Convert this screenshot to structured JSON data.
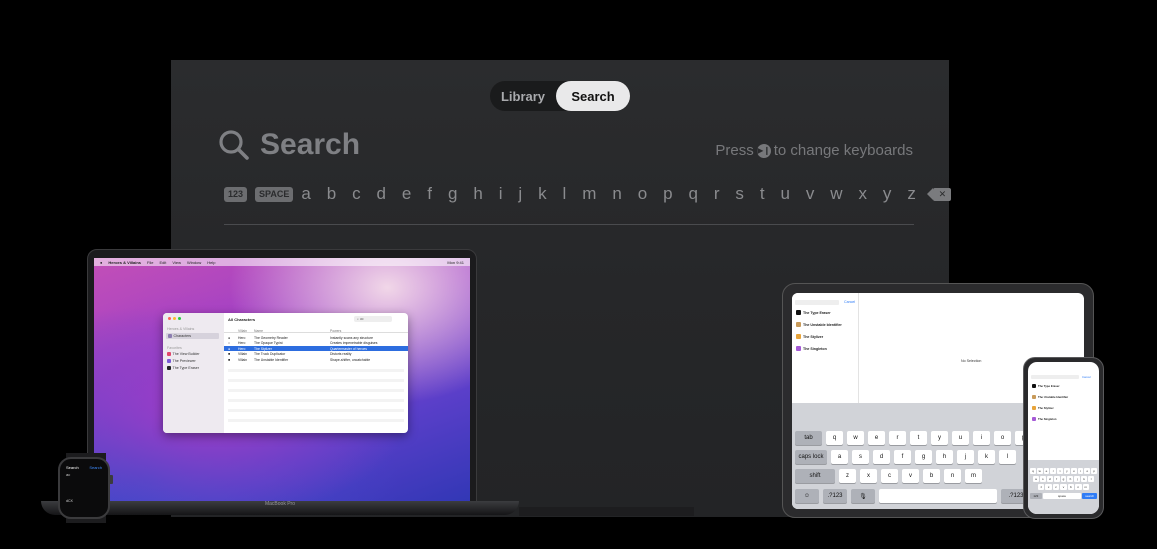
{
  "tv": {
    "tab_library": "Library",
    "tab_search": "Search",
    "search_placeholder": "Search",
    "hint_prefix": "Press",
    "hint_suffix": "to change keyboards",
    "key_123": "123",
    "key_space": "SPACE",
    "letters": "a b c d e f g h i j k l m n o p q r s t u v w x y z",
    "icons": {
      "search": "search-icon",
      "play_pause": "play-pause-icon",
      "delete": "delete-icon"
    }
  },
  "mac": {
    "menubar": {
      "app_name": "Heroes & Villains",
      "menus": [
        "File",
        "Edit",
        "View",
        "Window",
        "Help"
      ],
      "clock": "Mon 9:41"
    },
    "window": {
      "sidebar_heading": "Heroes & Villains",
      "sidebar_selected": "Characters",
      "sidebar_section": "Favorites",
      "favorites": [
        "The View Builder",
        "The Previewer",
        "The Type Eraser"
      ],
      "title": "All Characters",
      "search_value": "ac",
      "columns": [
        "Villain",
        "Name",
        "Powers"
      ],
      "rows": [
        {
          "type": "Hero",
          "name": "The Geometry Reader",
          "power": "Instantly scans any structure"
        },
        {
          "type": "Hero",
          "name": "The Opaque Typist",
          "power": "Creates impenetrable disguises"
        },
        {
          "type": "Hero",
          "name": "The Stylizer",
          "power": "Quartermaster of heroes"
        },
        {
          "type": "Villain",
          "name": "The Truck Duplicator",
          "power": "Distorts reality"
        },
        {
          "type": "Villain",
          "name": "The Unstable Identifier",
          "power": "Shape-shifter, uncatchable"
        }
      ]
    },
    "label": "MacBook Pro"
  },
  "ipad": {
    "cancel": "Cancel",
    "list": [
      "The Type Eraser",
      "The Unstable Identifier",
      "The Stylizer",
      "The Singleton"
    ],
    "no_selection": "No Selection",
    "kb_row1": [
      "q",
      "w",
      "e",
      "r",
      "t",
      "y",
      "u",
      "i",
      "o",
      "p"
    ],
    "kb_row2": [
      "a",
      "s",
      "d",
      "f",
      "g",
      "h",
      "j",
      "k",
      "l"
    ],
    "kb_row3": [
      "z",
      "x",
      "c",
      "v",
      "b",
      "n",
      "m"
    ],
    "key_tab": "tab",
    "key_caps": "caps lock",
    "key_shift": "shift",
    "key_num": ".?123"
  },
  "iphone": {
    "cancel": "Cancel",
    "list": [
      "The Type Eraser",
      "The Unstable Identifier",
      "The Stylizer",
      "The Singleton"
    ],
    "kb_row1": [
      "q",
      "w",
      "e",
      "r",
      "t",
      "y",
      "u",
      "i",
      "o",
      "p"
    ],
    "kb_row2": [
      "a",
      "s",
      "d",
      "f",
      "g",
      "h",
      "j",
      "k",
      "l"
    ],
    "kb_row3": [
      "z",
      "x",
      "c",
      "v",
      "b",
      "n",
      "m"
    ],
    "key_123": "123",
    "key_space": "space",
    "key_search": "search"
  },
  "watch": {
    "title": "Search",
    "action": "Search",
    "query": "ac",
    "keyboard": "dCX"
  },
  "colors": {
    "background": "#000000",
    "tv_panel": "#262729",
    "selection_blue": "#2d6ddf",
    "accent_blue": "#3d8bff"
  }
}
